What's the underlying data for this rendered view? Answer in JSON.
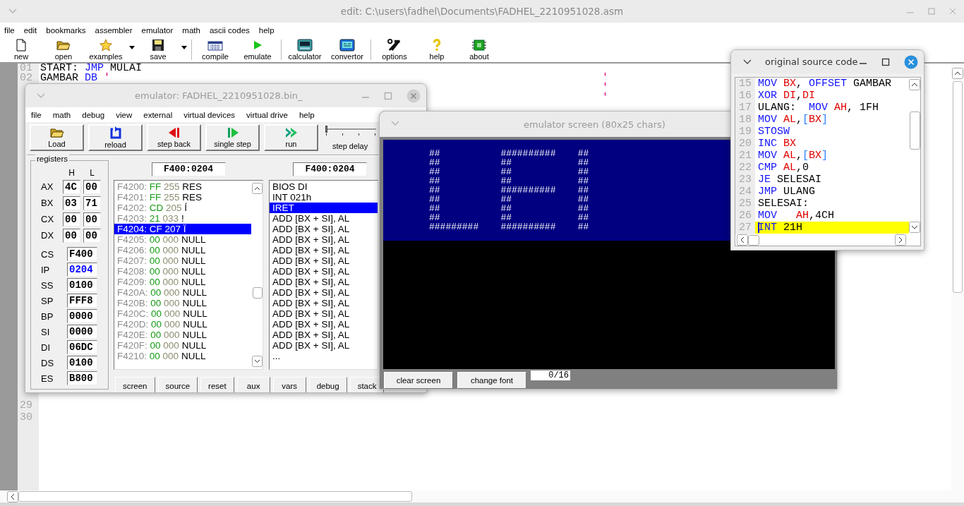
{
  "window": {
    "title": "edit: C:\\users\\fadhel\\Documents\\FADHEL_2210951028.asm",
    "active": false
  },
  "menu": [
    "file",
    "edit",
    "bookmarks",
    "assembler",
    "emulator",
    "math",
    "ascii codes",
    "help"
  ],
  "toolbar": {
    "groups": [
      [
        {
          "label": "new",
          "dropdown": false
        },
        {
          "label": "open",
          "dropdown": false
        },
        {
          "label": "examples",
          "dropdown": true
        },
        {
          "label": "save",
          "dropdown": true
        }
      ],
      [
        {
          "label": "compile",
          "dropdown": false
        },
        {
          "label": "emulate",
          "dropdown": false
        }
      ],
      [
        {
          "label": "calculator",
          "dropdown": false
        },
        {
          "label": "convertor",
          "dropdown": false
        }
      ],
      [
        {
          "label": "options",
          "dropdown": false
        },
        {
          "label": "help",
          "dropdown": false
        },
        {
          "label": "about",
          "dropdown": false
        }
      ]
    ]
  },
  "editor": {
    "top_lines": [
      {
        "number": "01",
        "code": [
          {
            "text": "START: ",
            "kind": "plain"
          },
          {
            "text": "JMP",
            "kind": "keyword"
          },
          {
            "text": " MULAI",
            "kind": "plain"
          }
        ]
      },
      {
        "number": "02",
        "code": [
          {
            "text": "GAMBAR ",
            "kind": "plain"
          },
          {
            "text": "DB",
            "kind": "keyword"
          },
          {
            "text": " '",
            "kind": "string"
          }
        ],
        "tail": "'"
      },
      {
        "tail": "'"
      },
      {
        "tail": "'"
      }
    ],
    "bottom_lines": [
      {
        "number": "29"
      },
      {
        "number": "30"
      }
    ]
  },
  "emulator": {
    "title": "emulator: FADHEL_2210951028.bin_",
    "active": false,
    "menu": [
      "file",
      "math",
      "debug",
      "view",
      "external",
      "virtual devices",
      "virtual drive",
      "help"
    ],
    "tools": [
      "Load",
      "reload",
      "step back",
      "single step",
      "run"
    ],
    "delay": {
      "label": "step delay",
      "level": 0
    },
    "registers": {
      "title": "registers",
      "columns": [
        "H",
        "L"
      ],
      "pairs": [
        {
          "name": "AX",
          "high": "4C",
          "low": "00"
        },
        {
          "name": "BX",
          "high": "03",
          "low": "71"
        },
        {
          "name": "CX",
          "high": "00",
          "low": "00"
        },
        {
          "name": "DX",
          "high": "00",
          "low": "00"
        }
      ],
      "words": [
        {
          "name": "CS",
          "value": "F400",
          "changed": false
        },
        {
          "name": "IP",
          "value": "0204",
          "changed": true
        },
        {
          "name": "SS",
          "value": "0100",
          "changed": false
        },
        {
          "name": "SP",
          "value": "FFF8",
          "changed": false
        },
        {
          "name": "BP",
          "value": "0000",
          "changed": false
        },
        {
          "name": "SI",
          "value": "0000",
          "changed": false
        },
        {
          "name": "DI",
          "value": "06DC",
          "changed": false
        },
        {
          "name": "DS",
          "value": "0100",
          "changed": false
        },
        {
          "name": "ES",
          "value": "B800",
          "changed": false
        }
      ]
    },
    "memory": {
      "address": "F400:0204",
      "rows": [
        {
          "address": "F4200:",
          "hex": "FF",
          "dec": "255",
          "char": "RES",
          "selected": false
        },
        {
          "address": "F4201:",
          "hex": "FF",
          "dec": "255",
          "char": "RES",
          "selected": false
        },
        {
          "address": "F4202:",
          "hex": "CD",
          "dec": "205",
          "char": "Í",
          "selected": false
        },
        {
          "address": "F4203:",
          "hex": "21",
          "dec": "033",
          "char": "!",
          "selected": false
        },
        {
          "address": "F4204:",
          "hex": "CF",
          "dec": "207",
          "char": "Ï",
          "selected": true
        },
        {
          "address": "F4205:",
          "hex": "00",
          "dec": "000",
          "char": "NULL",
          "selected": false
        },
        {
          "address": "F4206:",
          "hex": "00",
          "dec": "000",
          "char": "NULL",
          "selected": false
        },
        {
          "address": "F4207:",
          "hex": "00",
          "dec": "000",
          "char": "NULL",
          "selected": false
        },
        {
          "address": "F4208:",
          "hex": "00",
          "dec": "000",
          "char": "NULL",
          "selected": false
        },
        {
          "address": "F4209:",
          "hex": "00",
          "dec": "000",
          "char": "NULL",
          "selected": false
        },
        {
          "address": "F420A:",
          "hex": "00",
          "dec": "000",
          "char": "NULL",
          "selected": false
        },
        {
          "address": "F420B:",
          "hex": "00",
          "dec": "000",
          "char": "NULL",
          "selected": false
        },
        {
          "address": "F420C:",
          "hex": "00",
          "dec": "000",
          "char": "NULL",
          "selected": false
        },
        {
          "address": "F420D:",
          "hex": "00",
          "dec": "000",
          "char": "NULL",
          "selected": false
        },
        {
          "address": "F420E:",
          "hex": "00",
          "dec": "000",
          "char": "NULL",
          "selected": false
        },
        {
          "address": "F420F:",
          "hex": "00",
          "dec": "000",
          "char": "NULL",
          "selected": false
        },
        {
          "address": "F4210:",
          "hex": "00",
          "dec": "000",
          "char": "NULL",
          "selected": false
        }
      ]
    },
    "disassembly": {
      "address": "F400:0204",
      "rows": [
        {
          "text": "BIOS DI",
          "selected": false
        },
        {
          "text": "INT 021h",
          "selected": false
        },
        {
          "text": "IRET",
          "selected": true
        },
        {
          "text": "ADD [BX + SI], AL",
          "selected": false
        },
        {
          "text": "ADD [BX + SI], AL",
          "selected": false
        },
        {
          "text": "ADD [BX + SI], AL",
          "selected": false
        },
        {
          "text": "ADD [BX + SI], AL",
          "selected": false
        },
        {
          "text": "ADD [BX + SI], AL",
          "selected": false
        },
        {
          "text": "ADD [BX + SI], AL",
          "selected": false
        },
        {
          "text": "ADD [BX + SI], AL",
          "selected": false
        },
        {
          "text": "ADD [BX + SI], AL",
          "selected": false
        },
        {
          "text": "ADD [BX + SI], AL",
          "selected": false
        },
        {
          "text": "ADD [BX + SI], AL",
          "selected": false
        },
        {
          "text": "ADD [BX + SI], AL",
          "selected": false
        },
        {
          "text": "ADD [BX + SI], AL",
          "selected": false
        },
        {
          "text": "ADD [BX + SI], AL",
          "selected": false
        },
        {
          "text": "...",
          "selected": false
        }
      ]
    },
    "buttons": [
      "screen",
      "source",
      "reset",
      "aux",
      "vars",
      "debug",
      "stack"
    ]
  },
  "emulator_screen": {
    "title": "emulator screen (80x25 chars)",
    "active": false,
    "lines": [
      "##           ##########    ##",
      "##           ##            ##",
      "##           ##            ##",
      "##           ##            ##",
      "##           ##########    ##",
      "##           ##            ##",
      "##           ##            ##",
      "##           ##            ##",
      "#########    ##########    ##"
    ],
    "buttons": [
      "clear screen",
      "change font"
    ],
    "counter": "0/16"
  },
  "source": {
    "title": "original source code",
    "active": true,
    "lines": [
      {
        "number": "15",
        "selected": false,
        "code": [
          {
            "text": "MOV ",
            "kind": "keyword"
          },
          {
            "text": "BX",
            "kind": "register"
          },
          {
            "text": ", ",
            "kind": "plain"
          },
          {
            "text": "OFFSET",
            "kind": "keyword"
          },
          {
            "text": " GAMBAR",
            "kind": "plain"
          }
        ]
      },
      {
        "number": "16",
        "selected": false,
        "code": [
          {
            "text": "XOR ",
            "kind": "keyword"
          },
          {
            "text": "DI",
            "kind": "register"
          },
          {
            "text": ",",
            "kind": "plain"
          },
          {
            "text": "DI",
            "kind": "register"
          }
        ]
      },
      {
        "number": "17",
        "selected": false,
        "code": [
          {
            "text": "ULANG:  ",
            "kind": "plain"
          },
          {
            "text": "MOV ",
            "kind": "keyword"
          },
          {
            "text": "AH",
            "kind": "register"
          },
          {
            "text": ", 1FH",
            "kind": "plain"
          }
        ]
      },
      {
        "number": "18",
        "selected": false,
        "code": [
          {
            "text": "MOV ",
            "kind": "keyword"
          },
          {
            "text": "AL",
            "kind": "register"
          },
          {
            "text": ",",
            "kind": "plain"
          },
          {
            "text": "[",
            "kind": "bracket"
          },
          {
            "text": "BX",
            "kind": "register"
          },
          {
            "text": "]",
            "kind": "bracket"
          }
        ]
      },
      {
        "number": "19",
        "selected": false,
        "code": [
          {
            "text": "STOSW",
            "kind": "keyword"
          }
        ]
      },
      {
        "number": "20",
        "selected": false,
        "code": [
          {
            "text": "INC ",
            "kind": "keyword"
          },
          {
            "text": "BX",
            "kind": "register"
          }
        ]
      },
      {
        "number": "21",
        "selected": false,
        "code": [
          {
            "text": "MOV ",
            "kind": "keyword"
          },
          {
            "text": "AL",
            "kind": "register"
          },
          {
            "text": ",",
            "kind": "plain"
          },
          {
            "text": "[",
            "kind": "bracket"
          },
          {
            "text": "BX",
            "kind": "register"
          },
          {
            "text": "]",
            "kind": "bracket"
          }
        ]
      },
      {
        "number": "22",
        "selected": false,
        "code": [
          {
            "text": "CMP ",
            "kind": "keyword"
          },
          {
            "text": "AL",
            "kind": "register"
          },
          {
            "text": ",0",
            "kind": "plain"
          }
        ]
      },
      {
        "number": "23",
        "selected": false,
        "code": [
          {
            "text": "JE",
            "kind": "keyword"
          },
          {
            "text": " SELESAI",
            "kind": "plain"
          }
        ]
      },
      {
        "number": "24",
        "selected": false,
        "code": [
          {
            "text": "JMP",
            "kind": "keyword"
          },
          {
            "text": " ULANG",
            "kind": "plain"
          }
        ]
      },
      {
        "number": "25",
        "selected": false,
        "code": [
          {
            "text": "SELESAI:",
            "kind": "plain"
          }
        ]
      },
      {
        "number": "26",
        "selected": false,
        "code": [
          {
            "text": "MOV   ",
            "kind": "keyword"
          },
          {
            "text": "AH",
            "kind": "register"
          },
          {
            "text": ",4CH",
            "kind": "plain"
          }
        ]
      },
      {
        "number": "27",
        "selected": true,
        "code": [
          {
            "text": "INT",
            "kind": "keyword"
          },
          {
            "text": " 21H",
            "kind": "plain"
          }
        ]
      }
    ]
  }
}
